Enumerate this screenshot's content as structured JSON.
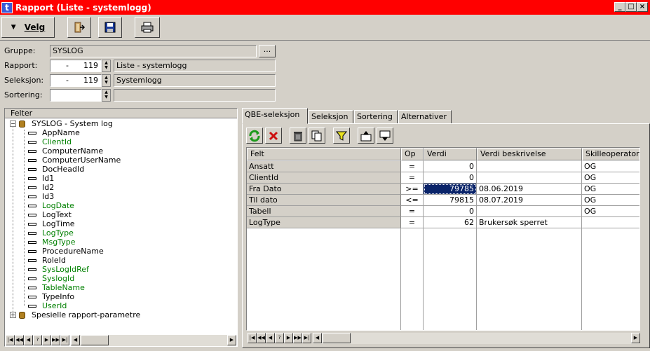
{
  "window": {
    "title": "Rapport (Liste - systemlogg)",
    "icon_letter": "t",
    "min_glyph": "_",
    "max_glyph": "□",
    "close_glyph": "×"
  },
  "toolbar": {
    "velg_label": "Velg",
    "velg_glyph": "▼"
  },
  "form": {
    "gruppe_label": "Gruppe:",
    "gruppe_value": "SYSLOG",
    "browse_label": "...",
    "rapport_label": "Rapport:",
    "rapport_prefix": "-",
    "rapport_number": "119",
    "rapport_desc": "Liste - systemlogg",
    "seleksjon_label": "Seleksjon:",
    "seleksjon_prefix": "-",
    "seleksjon_number": "119",
    "seleksjon_desc": "Systemlogg",
    "sortering_label": "Sortering:",
    "sortering_number": "",
    "sortering_desc": "",
    "spin_up": "▲",
    "spin_down": "▼"
  },
  "tree": {
    "header": "Felter",
    "root_label": "SYSLOG - System log",
    "root_toggle": "−",
    "items": [
      {
        "label": "AppName",
        "green": false
      },
      {
        "label": "ClientId",
        "green": true
      },
      {
        "label": "ComputerName",
        "green": false
      },
      {
        "label": "ComputerUserName",
        "green": false
      },
      {
        "label": "DocHeadId",
        "green": false
      },
      {
        "label": "Id1",
        "green": false
      },
      {
        "label": "Id2",
        "green": false
      },
      {
        "label": "Id3",
        "green": false
      },
      {
        "label": "LogDate",
        "green": true
      },
      {
        "label": "LogText",
        "green": false
      },
      {
        "label": "LogTime",
        "green": false
      },
      {
        "label": "LogType",
        "green": true
      },
      {
        "label": "MsgType",
        "green": true
      },
      {
        "label": "ProcedureName",
        "green": false
      },
      {
        "label": "RoleId",
        "green": false
      },
      {
        "label": "SysLogIdRef",
        "green": true
      },
      {
        "label": "SyslogId",
        "green": true
      },
      {
        "label": "TableName",
        "green": true
      },
      {
        "label": "TypeInfo",
        "green": false
      },
      {
        "label": "UserId",
        "green": true
      }
    ],
    "second_root_label": "Spesielle rapport-parametre",
    "second_root_toggle": "+"
  },
  "nav": {
    "first": "|◀",
    "prev_page": "◀◀",
    "prev": "◀",
    "help": "?",
    "next": "▶",
    "next_page": "▶▶",
    "last": "▶|",
    "scroll_left": "◀",
    "scroll_right": "▶"
  },
  "tabs": [
    {
      "label": "QBE-seleksjon"
    },
    {
      "label": "Seleksjon"
    },
    {
      "label": "Sortering"
    },
    {
      "label": "Alternativer"
    }
  ],
  "grid": {
    "headers": [
      "Felt",
      "Op",
      "Verdi",
      "Verdi beskrivelse",
      "Skilleoperator"
    ],
    "rows": [
      {
        "felt": "Ansatt",
        "op": "=",
        "verdi": "0",
        "beskrivelse": "",
        "skille": "OG"
      },
      {
        "felt": "ClientId",
        "op": "=",
        "verdi": "0",
        "beskrivelse": "",
        "skille": "OG"
      },
      {
        "felt": "Fra Dato",
        "op": ">=",
        "verdi": "79785",
        "beskrivelse": "08.06.2019",
        "skille": "OG"
      },
      {
        "felt": "Til dato",
        "op": "<=",
        "verdi": "79815",
        "beskrivelse": "08.07.2019",
        "skille": "OG"
      },
      {
        "felt": "Tabell",
        "op": "=",
        "verdi": "0",
        "beskrivelse": "",
        "skille": "OG"
      },
      {
        "felt": "LogType",
        "op": "=",
        "verdi": "62",
        "beskrivelse": "Brukersøk sperret",
        "skille": ""
      }
    ]
  },
  "colors": {
    "titlebar": "#ff0000",
    "selection": "#0a246a",
    "green_field": "#008000",
    "refresh_icon": "#1c9a1c",
    "delete_icon": "#cc1010"
  }
}
